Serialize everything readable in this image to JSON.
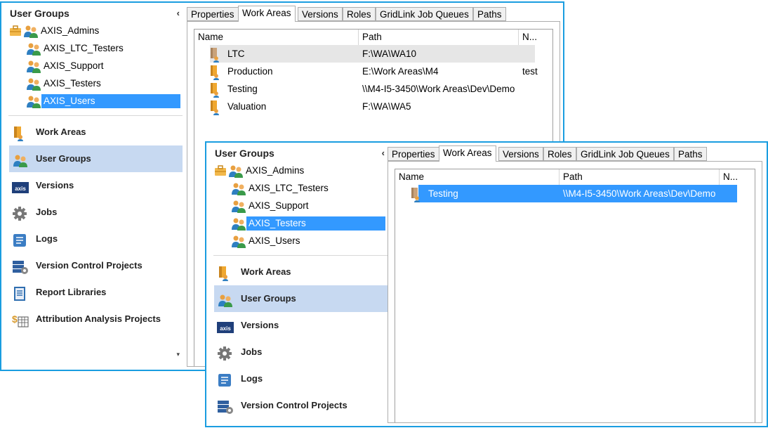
{
  "window1": {
    "header": "User Groups",
    "collapse_glyph": "‹",
    "tree": [
      {
        "label": "AXIS_Admins",
        "icon": "admin-group-icon"
      },
      {
        "label": "AXIS_LTC_Testers",
        "icon": "user-group-icon"
      },
      {
        "label": "AXIS_Support",
        "icon": "user-group-icon"
      },
      {
        "label": "AXIS_Testers",
        "icon": "user-group-icon"
      },
      {
        "label": "AXIS_Users",
        "icon": "user-group-icon",
        "selected": true
      }
    ],
    "nav": [
      {
        "label": "Work Areas",
        "icon": "work-area-icon"
      },
      {
        "label": "User Groups",
        "icon": "user-group-icon",
        "active": true
      },
      {
        "label": "Versions",
        "icon": "axis-logo-icon"
      },
      {
        "label": "Jobs",
        "icon": "gear-icon"
      },
      {
        "label": "Logs",
        "icon": "scroll-icon"
      },
      {
        "label": "Version Control Projects",
        "icon": "server-icon"
      },
      {
        "label": "Report Libraries",
        "icon": "book-icon"
      },
      {
        "label": "Attribution Analysis Projects",
        "icon": "dollar-chart-icon"
      }
    ],
    "scroll_down_glyph": "▾",
    "tabs": [
      "Properties",
      "Work Areas",
      "Versions",
      "Roles",
      "GridLink Job Queues",
      "Paths"
    ],
    "active_tab": "Work Areas",
    "columns": [
      "Name",
      "Path",
      "N..."
    ],
    "rows": [
      {
        "name": "LTC",
        "path": "F:\\WA\\WA10",
        "n": "",
        "state": "hover"
      },
      {
        "name": "Production",
        "path": "E:\\Work Areas\\M4",
        "n": "test"
      },
      {
        "name": "Testing",
        "path": "\\\\M4-I5-3450\\Work Areas\\Dev\\Demo",
        "n": ""
      },
      {
        "name": "Valuation",
        "path": "F:\\WA\\WA5",
        "n": ""
      }
    ]
  },
  "window2": {
    "header": "User Groups",
    "collapse_glyph": "‹",
    "tree": [
      {
        "label": "AXIS_Admins",
        "icon": "admin-group-icon"
      },
      {
        "label": "AXIS_LTC_Testers",
        "icon": "user-group-icon"
      },
      {
        "label": "AXIS_Support",
        "icon": "user-group-icon"
      },
      {
        "label": "AXIS_Testers",
        "icon": "user-group-icon",
        "selected": true
      },
      {
        "label": "AXIS_Users",
        "icon": "user-group-icon"
      }
    ],
    "nav": [
      {
        "label": "Work Areas",
        "icon": "work-area-icon"
      },
      {
        "label": "User Groups",
        "icon": "user-group-icon",
        "active": true
      },
      {
        "label": "Versions",
        "icon": "axis-logo-icon"
      },
      {
        "label": "Jobs",
        "icon": "gear-icon"
      },
      {
        "label": "Logs",
        "icon": "scroll-icon"
      },
      {
        "label": "Version Control Projects",
        "icon": "server-icon"
      }
    ],
    "tabs": [
      "Properties",
      "Work Areas",
      "Versions",
      "Roles",
      "GridLink Job Queues",
      "Paths"
    ],
    "active_tab": "Work Areas",
    "columns": [
      "Name",
      "Path",
      "N..."
    ],
    "rows": [
      {
        "name": "Testing",
        "path": "\\\\M4-I5-3450\\Work Areas\\Dev\\Demo",
        "n": "",
        "state": "selected"
      }
    ]
  },
  "axis_logo_text": "axis",
  "colors": {
    "accent": "#1a9de0",
    "selection": "#3399ff",
    "nav_active": "#c7d9f1",
    "folder": "#f0a830"
  }
}
